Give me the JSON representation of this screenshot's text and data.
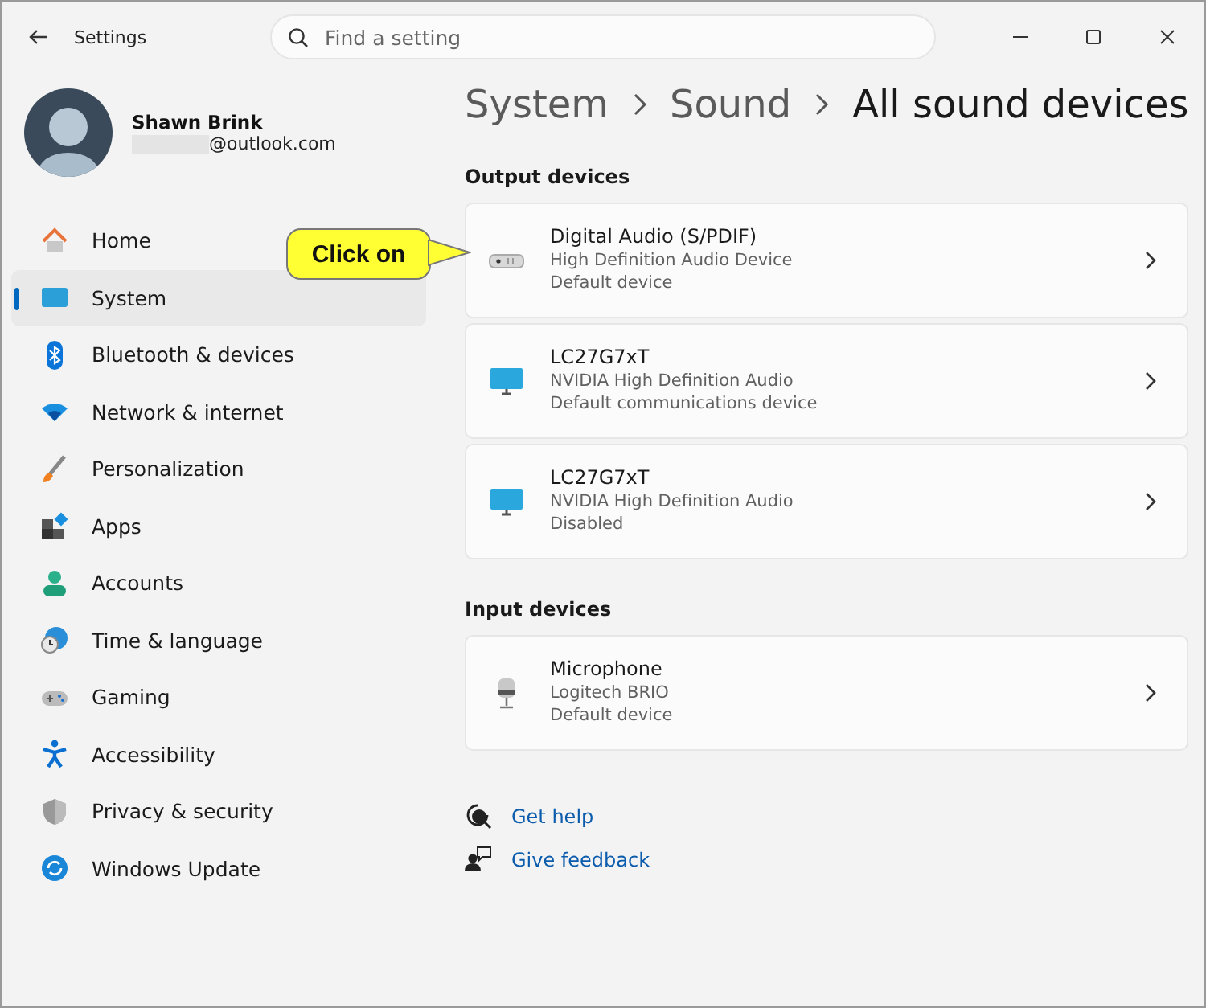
{
  "window": {
    "title": "Settings"
  },
  "search": {
    "placeholder": "Find a setting"
  },
  "account": {
    "name": "Shawn Brink",
    "email": "@outlook.com"
  },
  "sidebar": {
    "items": [
      {
        "label": "Home",
        "selected": false
      },
      {
        "label": "System",
        "selected": true
      },
      {
        "label": "Bluetooth & devices",
        "selected": false
      },
      {
        "label": "Network & internet",
        "selected": false
      },
      {
        "label": "Personalization",
        "selected": false
      },
      {
        "label": "Apps",
        "selected": false
      },
      {
        "label": "Accounts",
        "selected": false
      },
      {
        "label": "Time & language",
        "selected": false
      },
      {
        "label": "Gaming",
        "selected": false
      },
      {
        "label": "Accessibility",
        "selected": false
      },
      {
        "label": "Privacy & security",
        "selected": false
      },
      {
        "label": "Windows Update",
        "selected": false
      }
    ]
  },
  "breadcrumb": [
    "System",
    "Sound",
    "All sound devices"
  ],
  "sections": [
    {
      "title": "Output devices",
      "devices": [
        {
          "kind": "speaker",
          "name": "Digital Audio (S/PDIF)",
          "driver": "High Definition Audio Device",
          "status": "Default device"
        },
        {
          "kind": "monitor",
          "name": "LC27G7xT",
          "driver": "NVIDIA High Definition Audio",
          "status": "Default communications device"
        },
        {
          "kind": "monitor",
          "name": "LC27G7xT",
          "driver": "NVIDIA High Definition Audio",
          "status": "Disabled"
        }
      ]
    },
    {
      "title": "Input devices",
      "devices": [
        {
          "kind": "microphone",
          "name": "Microphone",
          "driver": "Logitech BRIO",
          "status": "Default device"
        }
      ]
    }
  ],
  "links": [
    {
      "kind": "help",
      "label": "Get help"
    },
    {
      "kind": "feedback",
      "label": "Give feedback"
    }
  ],
  "callout": {
    "text": "Click on"
  }
}
